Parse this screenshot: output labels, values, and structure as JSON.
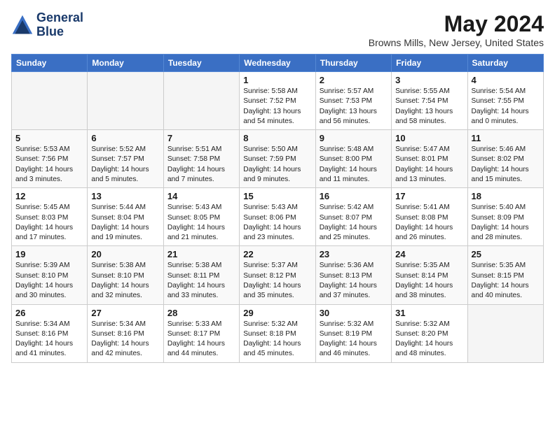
{
  "brand": {
    "line1": "General",
    "line2": "Blue"
  },
  "title": "May 2024",
  "location": "Browns Mills, New Jersey, United States",
  "weekdays": [
    "Sunday",
    "Monday",
    "Tuesday",
    "Wednesday",
    "Thursday",
    "Friday",
    "Saturday"
  ],
  "weeks": [
    [
      {
        "day": "",
        "info": ""
      },
      {
        "day": "",
        "info": ""
      },
      {
        "day": "",
        "info": ""
      },
      {
        "day": "1",
        "info": "Sunrise: 5:58 AM\nSunset: 7:52 PM\nDaylight: 13 hours\nand 54 minutes."
      },
      {
        "day": "2",
        "info": "Sunrise: 5:57 AM\nSunset: 7:53 PM\nDaylight: 13 hours\nand 56 minutes."
      },
      {
        "day": "3",
        "info": "Sunrise: 5:55 AM\nSunset: 7:54 PM\nDaylight: 13 hours\nand 58 minutes."
      },
      {
        "day": "4",
        "info": "Sunrise: 5:54 AM\nSunset: 7:55 PM\nDaylight: 14 hours\nand 0 minutes."
      }
    ],
    [
      {
        "day": "5",
        "info": "Sunrise: 5:53 AM\nSunset: 7:56 PM\nDaylight: 14 hours\nand 3 minutes."
      },
      {
        "day": "6",
        "info": "Sunrise: 5:52 AM\nSunset: 7:57 PM\nDaylight: 14 hours\nand 5 minutes."
      },
      {
        "day": "7",
        "info": "Sunrise: 5:51 AM\nSunset: 7:58 PM\nDaylight: 14 hours\nand 7 minutes."
      },
      {
        "day": "8",
        "info": "Sunrise: 5:50 AM\nSunset: 7:59 PM\nDaylight: 14 hours\nand 9 minutes."
      },
      {
        "day": "9",
        "info": "Sunrise: 5:48 AM\nSunset: 8:00 PM\nDaylight: 14 hours\nand 11 minutes."
      },
      {
        "day": "10",
        "info": "Sunrise: 5:47 AM\nSunset: 8:01 PM\nDaylight: 14 hours\nand 13 minutes."
      },
      {
        "day": "11",
        "info": "Sunrise: 5:46 AM\nSunset: 8:02 PM\nDaylight: 14 hours\nand 15 minutes."
      }
    ],
    [
      {
        "day": "12",
        "info": "Sunrise: 5:45 AM\nSunset: 8:03 PM\nDaylight: 14 hours\nand 17 minutes."
      },
      {
        "day": "13",
        "info": "Sunrise: 5:44 AM\nSunset: 8:04 PM\nDaylight: 14 hours\nand 19 minutes."
      },
      {
        "day": "14",
        "info": "Sunrise: 5:43 AM\nSunset: 8:05 PM\nDaylight: 14 hours\nand 21 minutes."
      },
      {
        "day": "15",
        "info": "Sunrise: 5:43 AM\nSunset: 8:06 PM\nDaylight: 14 hours\nand 23 minutes."
      },
      {
        "day": "16",
        "info": "Sunrise: 5:42 AM\nSunset: 8:07 PM\nDaylight: 14 hours\nand 25 minutes."
      },
      {
        "day": "17",
        "info": "Sunrise: 5:41 AM\nSunset: 8:08 PM\nDaylight: 14 hours\nand 26 minutes."
      },
      {
        "day": "18",
        "info": "Sunrise: 5:40 AM\nSunset: 8:09 PM\nDaylight: 14 hours\nand 28 minutes."
      }
    ],
    [
      {
        "day": "19",
        "info": "Sunrise: 5:39 AM\nSunset: 8:10 PM\nDaylight: 14 hours\nand 30 minutes."
      },
      {
        "day": "20",
        "info": "Sunrise: 5:38 AM\nSunset: 8:10 PM\nDaylight: 14 hours\nand 32 minutes."
      },
      {
        "day": "21",
        "info": "Sunrise: 5:38 AM\nSunset: 8:11 PM\nDaylight: 14 hours\nand 33 minutes."
      },
      {
        "day": "22",
        "info": "Sunrise: 5:37 AM\nSunset: 8:12 PM\nDaylight: 14 hours\nand 35 minutes."
      },
      {
        "day": "23",
        "info": "Sunrise: 5:36 AM\nSunset: 8:13 PM\nDaylight: 14 hours\nand 37 minutes."
      },
      {
        "day": "24",
        "info": "Sunrise: 5:35 AM\nSunset: 8:14 PM\nDaylight: 14 hours\nand 38 minutes."
      },
      {
        "day": "25",
        "info": "Sunrise: 5:35 AM\nSunset: 8:15 PM\nDaylight: 14 hours\nand 40 minutes."
      }
    ],
    [
      {
        "day": "26",
        "info": "Sunrise: 5:34 AM\nSunset: 8:16 PM\nDaylight: 14 hours\nand 41 minutes."
      },
      {
        "day": "27",
        "info": "Sunrise: 5:34 AM\nSunset: 8:16 PM\nDaylight: 14 hours\nand 42 minutes."
      },
      {
        "day": "28",
        "info": "Sunrise: 5:33 AM\nSunset: 8:17 PM\nDaylight: 14 hours\nand 44 minutes."
      },
      {
        "day": "29",
        "info": "Sunrise: 5:32 AM\nSunset: 8:18 PM\nDaylight: 14 hours\nand 45 minutes."
      },
      {
        "day": "30",
        "info": "Sunrise: 5:32 AM\nSunset: 8:19 PM\nDaylight: 14 hours\nand 46 minutes."
      },
      {
        "day": "31",
        "info": "Sunrise: 5:32 AM\nSunset: 8:20 PM\nDaylight: 14 hours\nand 48 minutes."
      },
      {
        "day": "",
        "info": ""
      }
    ]
  ]
}
